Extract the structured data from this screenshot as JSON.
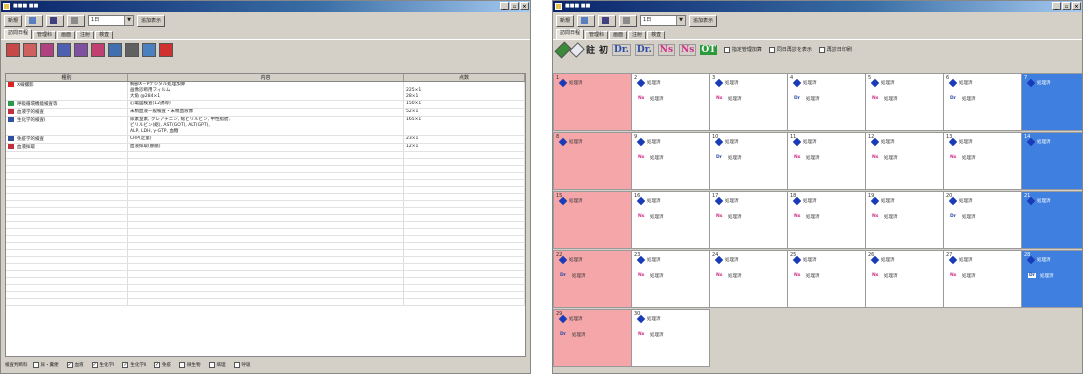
{
  "colors": {
    "sunday": "#f4a6a8",
    "saturday": "#3f7fe0",
    "nurse": "#d0308a",
    "doctor": "#2a4aa8",
    "titlebar": "#0a246a"
  },
  "win1": {
    "title": "■■■ ■■",
    "controls": [
      "_",
      "▫",
      "×"
    ],
    "toolbar": {
      "new_label": "新規",
      "combo_value": "1日",
      "add_label": "追加表示"
    },
    "tabs": [
      "訪問日程",
      "管理科",
      "画面",
      "注射",
      "検査"
    ],
    "table": {
      "headers": [
        "種別",
        "内容",
        "点数"
      ],
      "rows": [
        {
          "icon": "x-icon",
          "color": "#d22",
          "kind": "X線撮影",
          "content": [
            "胸部X－Pデジタル処理加算",
            "画像診断用フィルム",
            "大角 @284×1"
          ],
          "points": [
            "",
            "225×1",
            "28×1"
          ]
        },
        {
          "icon": "ecg-icon",
          "color": "#2a9a4a",
          "kind": "呼吸循環機能検査等",
          "content": [
            "心電図検査(12誘導)"
          ],
          "points": [
            "150×1"
          ]
        },
        {
          "icon": "test-icon",
          "color": "#c03040",
          "kind": "血液学的検査",
          "content": [
            "末梢血液一般検査・末梢血液像"
          ],
          "points": [
            "52×1"
          ]
        },
        {
          "icon": "test-icon",
          "color": "#3050a0",
          "kind": "生化学的検査Ⅰ",
          "content": [
            "尿素窒素, クレアチニン, 総ビリルビン, 中性脂肪,",
            "ビリルビン(総), AST(GOT), ALT(GPT),",
            "ALP, LDH, γ-GTP, 血糖"
          ],
          "points": [
            "165×1",
            "",
            ""
          ]
        },
        {
          "icon": "test-icon",
          "color": "#3050a0",
          "kind": "免疫学的検査",
          "content": [
            "CRP(定量)"
          ],
          "points": [
            "23×1"
          ]
        },
        {
          "icon": "test-icon",
          "color": "#c03040",
          "kind": "血液採取",
          "content": [
            "血液採取(静脈)"
          ],
          "points": [
            "12×1"
          ]
        }
      ],
      "empty_rows": 22
    },
    "status": {
      "label": "検査判断料",
      "checks": [
        {
          "label": "尿・糞便",
          "checked": false
        },
        {
          "label": "血液",
          "checked": true
        },
        {
          "label": "生化学Ⅰ",
          "checked": true
        },
        {
          "label": "生化学Ⅱ",
          "checked": true
        },
        {
          "label": "免疫",
          "checked": true
        },
        {
          "label": "微生物",
          "checked": false
        },
        {
          "label": "病理",
          "checked": false
        },
        {
          "label": "呼吸",
          "checked": false
        }
      ]
    }
  },
  "win2": {
    "title": "■■■ ■■",
    "controls": [
      "_",
      "▫",
      "×"
    ],
    "toolbar": {
      "new_label": "新規",
      "combo_value": "1日",
      "add_label": "追加表示"
    },
    "tabs": [
      "訪問日程",
      "管理科",
      "画面",
      "注射",
      "検査"
    ],
    "iconbar": {
      "ichi": "註",
      "sho": "初",
      "dr1": "Dr.",
      "dr2": "Dr.",
      "ns1": "Ns",
      "ns2": "Ns",
      "ot": "OT",
      "checks": [
        "指定管理加算",
        "同日再診を表示",
        "再診日印刷"
      ]
    },
    "calendar": [
      {
        "day": "1",
        "col": 0,
        "row": 0,
        "mark": "処理済",
        "badge": "",
        "blabel": ""
      },
      {
        "day": "2",
        "col": 1,
        "row": 0,
        "mark": "処理済",
        "badge": "Ns",
        "blabel": "処理済"
      },
      {
        "day": "3",
        "col": 2,
        "row": 0,
        "mark": "処理済",
        "badge": "Ns",
        "blabel": "処理済"
      },
      {
        "day": "4",
        "col": 3,
        "row": 0,
        "mark": "処理済",
        "badge": "Dr",
        "blabel": "処理済"
      },
      {
        "day": "5",
        "col": 4,
        "row": 0,
        "mark": "処理済",
        "badge": "Ns",
        "blabel": "処理済"
      },
      {
        "day": "6",
        "col": 5,
        "row": 0,
        "mark": "処理済",
        "badge": "Dr",
        "blabel": "処理済"
      },
      {
        "day": "7",
        "col": 6,
        "row": 0,
        "mark": "処理済",
        "badge": "",
        "blabel": ""
      },
      {
        "day": "8",
        "col": 0,
        "row": 1,
        "mark": "処理済",
        "badge": "",
        "blabel": ""
      },
      {
        "day": "9",
        "col": 1,
        "row": 1,
        "mark": "処理済",
        "badge": "Ns",
        "blabel": "処理済"
      },
      {
        "day": "10",
        "col": 2,
        "row": 1,
        "mark": "処理済",
        "badge": "Dr",
        "blabel": "処理済"
      },
      {
        "day": "11",
        "col": 3,
        "row": 1,
        "mark": "処理済",
        "badge": "Ns",
        "blabel": "処理済"
      },
      {
        "day": "12",
        "col": 4,
        "row": 1,
        "mark": "処理済",
        "badge": "Ns",
        "blabel": "処理済"
      },
      {
        "day": "13",
        "col": 5,
        "row": 1,
        "mark": "処理済",
        "badge": "Ns",
        "blabel": "処理済"
      },
      {
        "day": "14",
        "col": 6,
        "row": 1,
        "mark": "処理済",
        "badge": "",
        "blabel": ""
      },
      {
        "day": "15",
        "col": 0,
        "row": 2,
        "mark": "処理済",
        "badge": "",
        "blabel": ""
      },
      {
        "day": "16",
        "col": 1,
        "row": 2,
        "mark": "処理済",
        "badge": "Ns",
        "blabel": "処理済"
      },
      {
        "day": "17",
        "col": 2,
        "row": 2,
        "mark": "処理済",
        "badge": "Ns",
        "blabel": "処理済"
      },
      {
        "day": "18",
        "col": 3,
        "row": 2,
        "mark": "処理済",
        "badge": "Ns",
        "blabel": "処理済"
      },
      {
        "day": "19",
        "col": 4,
        "row": 2,
        "mark": "処理済",
        "badge": "Ns",
        "blabel": "処理済"
      },
      {
        "day": "20",
        "col": 5,
        "row": 2,
        "mark": "処理済",
        "badge": "Dr",
        "blabel": "処理済"
      },
      {
        "day": "21",
        "col": 6,
        "row": 2,
        "mark": "処理済",
        "badge": "",
        "blabel": ""
      },
      {
        "day": "22",
        "col": 0,
        "row": 3,
        "mark": "処理済",
        "badge": "Dr",
        "blabel": "処理済"
      },
      {
        "day": "23",
        "col": 1,
        "row": 3,
        "mark": "処理済",
        "badge": "Ns",
        "blabel": "処理済"
      },
      {
        "day": "24",
        "col": 2,
        "row": 3,
        "mark": "処理済",
        "badge": "Ns",
        "blabel": "処理済"
      },
      {
        "day": "25",
        "col": 3,
        "row": 3,
        "mark": "処理済",
        "badge": "Ns",
        "blabel": "処理済"
      },
      {
        "day": "26",
        "col": 4,
        "row": 3,
        "mark": "処理済",
        "badge": "Ns",
        "blabel": "処理済"
      },
      {
        "day": "27",
        "col": 5,
        "row": 3,
        "mark": "処理済",
        "badge": "Ns",
        "blabel": "処理済"
      },
      {
        "day": "28",
        "col": 6,
        "row": 3,
        "mark": "処理済",
        "badge": "Dr",
        "blabel": "処理済"
      },
      {
        "day": "29",
        "col": 0,
        "row": 4,
        "mark": "処理済",
        "badge": "Dr",
        "blabel": "処理済"
      },
      {
        "day": "30",
        "col": 1,
        "row": 4,
        "mark": "処理済",
        "badge": "Ns",
        "blabel": "処理済"
      }
    ]
  }
}
